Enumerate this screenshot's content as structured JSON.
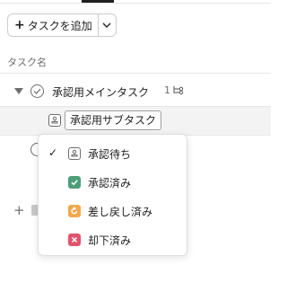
{
  "toolbar": {
    "add_task_label": "タスクを追加"
  },
  "list": {
    "column_header": "タスク名",
    "parent_task": {
      "title": "承認用メインタスク",
      "subtask_count": "1"
    },
    "subtask": {
      "title": "承認用サブタスク"
    }
  },
  "status_menu": {
    "items": [
      {
        "label": "承認待ち",
        "icon": "approval-pending-icon",
        "selected": true,
        "color": "#6d6e6f"
      },
      {
        "label": "承認済み",
        "icon": "approved-check-icon",
        "selected": false,
        "color": "#4d9e78"
      },
      {
        "label": "差し戻し済み",
        "icon": "changes-requested-icon",
        "selected": false,
        "color": "#f1a84c"
      },
      {
        "label": "却下済み",
        "icon": "rejected-x-icon",
        "selected": false,
        "color": "#e0546b"
      }
    ]
  }
}
